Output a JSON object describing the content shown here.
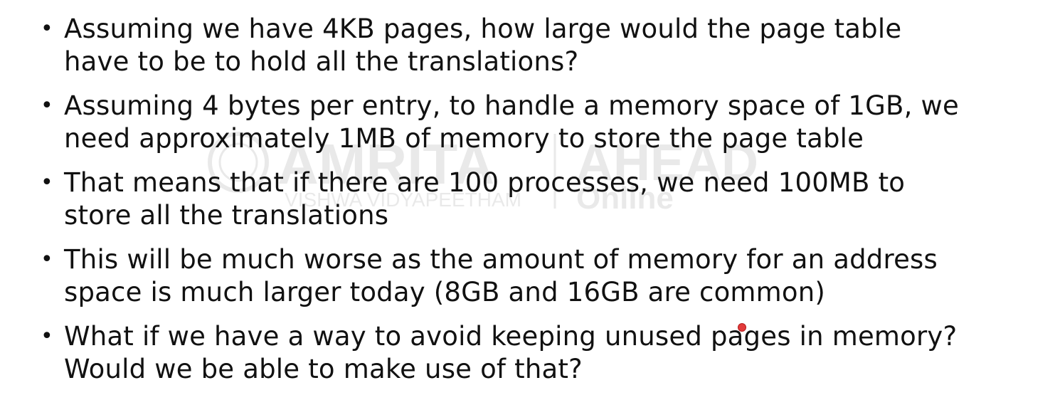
{
  "slide": {
    "bullets": [
      {
        "lines": [
          "Assuming we have 4KB pages, how large would the page table",
          "have to be to hold all the translations?"
        ]
      },
      {
        "lines": [
          "Assuming 4 bytes per entry, to handle a memory space of 1GB, we",
          "need approximately 1MB of memory to store the page table"
        ]
      },
      {
        "lines": [
          "That means that if there are 100 processes, we need 100MB to",
          "store all the translations"
        ]
      },
      {
        "lines": [
          "This will be much worse as the amount of memory for an address",
          "space is much larger today (8GB and 16GB are common)"
        ]
      },
      {
        "lines": [
          "What if we have a way to avoid keeping unused pages in memory?",
          "Would we be able to make use of that?"
        ]
      }
    ],
    "bullet_glyph": "•"
  },
  "watermark": {
    "brand": "AMRITA",
    "subtitle": "VISHWA VIDYAPEETHAM",
    "secondary": "AHEAD",
    "secondary_sub": "Online"
  },
  "colors": {
    "text": "#111111",
    "background": "#ffffff",
    "cursor": "#e23b3b"
  }
}
